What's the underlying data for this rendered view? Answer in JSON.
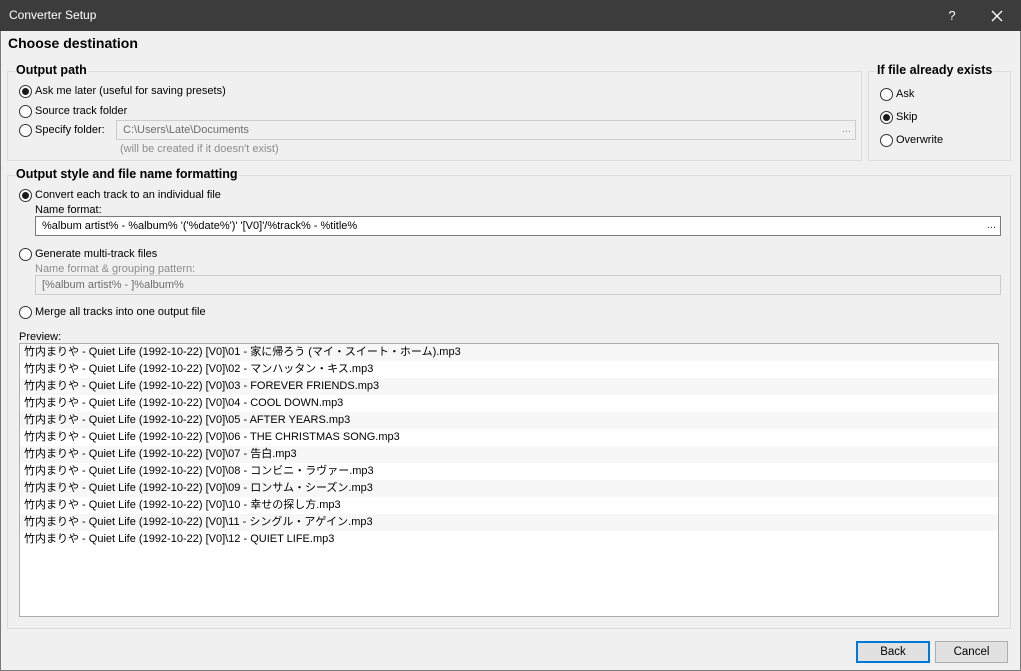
{
  "window": {
    "title": "Converter Setup",
    "help_glyph": "?",
    "close_glyph": "✕"
  },
  "page_title": "Choose destination",
  "output_path": {
    "title": "Output path",
    "options": [
      {
        "label": "Ask me later (useful for saving presets)",
        "checked": true
      },
      {
        "label": "Source track folder",
        "checked": false
      },
      {
        "label": "Specify folder:",
        "checked": false
      }
    ],
    "folder_value": "C:\\Users\\Late\\Documents",
    "browse_label": "...",
    "folder_note": "(will be created if it doesn't exist)"
  },
  "if_exists": {
    "title": "If file already exists",
    "options": [
      {
        "label": "Ask",
        "checked": false
      },
      {
        "label": "Skip",
        "checked": true
      },
      {
        "label": "Overwrite",
        "checked": false
      }
    ]
  },
  "output_style": {
    "title": "Output style and file name formatting",
    "individual_label": "Convert each track to an individual file",
    "name_format_label": "Name format:",
    "name_format_value": "%album artist% - %album% '('%date%')' '[V0]'/%track% - %title%",
    "browse_label": "...",
    "multitrack_label": "Generate multi-track files",
    "grouping_label": "Name format & grouping pattern:",
    "grouping_value": "[%album artist% - ]%album%",
    "merge_label": "Merge all tracks into one output file"
  },
  "preview": {
    "label": "Preview:",
    "rows": [
      "竹内まりや - Quiet Life (1992-10-22) [V0]\\01 - 家に帰ろう (マイ・スイート・ホーム).mp3",
      "竹内まりや - Quiet Life (1992-10-22) [V0]\\02 - マンハッタン・キス.mp3",
      "竹内まりや - Quiet Life (1992-10-22) [V0]\\03 - FOREVER FRIENDS.mp3",
      "竹内まりや - Quiet Life (1992-10-22) [V0]\\04 - COOL DOWN.mp3",
      "竹内まりや - Quiet Life (1992-10-22) [V0]\\05 - AFTER YEARS.mp3",
      "竹内まりや - Quiet Life (1992-10-22) [V0]\\06 - THE CHRISTMAS SONG.mp3",
      "竹内まりや - Quiet Life (1992-10-22) [V0]\\07 - 告白.mp3",
      "竹内まりや - Quiet Life (1992-10-22) [V0]\\08 - コンビニ・ラヴァー.mp3",
      "竹内まりや - Quiet Life (1992-10-22) [V0]\\09 - ロンサム・シーズン.mp3",
      "竹内まりや - Quiet Life (1992-10-22) [V0]\\10 - 幸せの探し方.mp3",
      "竹内まりや - Quiet Life (1992-10-22) [V0]\\11 - シングル・アゲイン.mp3",
      "竹内まりや - Quiet Life (1992-10-22) [V0]\\12 - QUIET LIFE.mp3"
    ]
  },
  "buttons": {
    "back": "Back",
    "cancel": "Cancel"
  },
  "colors": {
    "titlebar": "#3c3c3c",
    "dialog_bg": "#f0f0f0",
    "default_button_border": "#0078d7"
  }
}
